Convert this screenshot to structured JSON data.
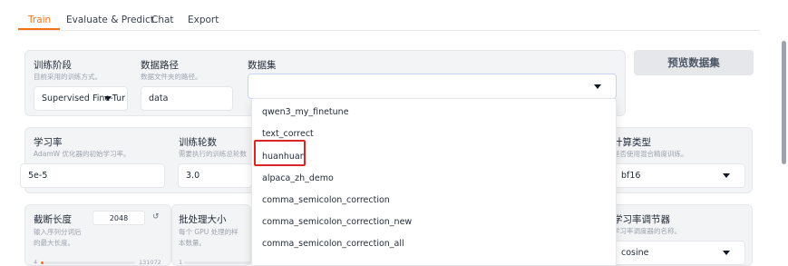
{
  "tabs": [
    {
      "label": "Train",
      "active": true
    },
    {
      "label": "Evaluate & Predict",
      "active": false
    },
    {
      "label": "Chat",
      "active": false
    },
    {
      "label": "Export",
      "active": false
    }
  ],
  "accent_color": "#f97316",
  "highlight_color": "#dc2626",
  "stage": {
    "label": "训练阶段",
    "desc": "目前采用的训练方式。",
    "value": "Supervised Fine-Tur"
  },
  "data_path": {
    "label": "数据路径",
    "desc": "数据文件夹的路径。",
    "value": "data"
  },
  "dataset": {
    "label": "数据集",
    "value": ""
  },
  "preview_button": {
    "label": "预览数据集"
  },
  "learning_rate": {
    "label": "学习率",
    "desc": "AdamW 优化器的初始学习率。",
    "value": "5e-5"
  },
  "epochs": {
    "label": "训练轮数",
    "desc": "需要执行的训练总轮数",
    "value": "3.0"
  },
  "compute_type": {
    "label": "计算类型",
    "desc": "是否使用混合精度训练。",
    "value": "bf16"
  },
  "cutoff_len": {
    "label": "截断长度",
    "desc_line1": "输入序列分词后",
    "desc_line2": "的最大长度。",
    "value": "2048",
    "min": "4",
    "max": "131072",
    "level_fraction": 0.015
  },
  "batch_size": {
    "label": "批处理大小",
    "desc_line1": "每个 GPU 处理的样",
    "desc_line2": "本数量。",
    "min": "1",
    "max": "1024"
  },
  "other_slider": {
    "min": "0"
  },
  "lr_scheduler": {
    "label": "学习率调节器",
    "desc": "学习率调度器的名称。",
    "value": "cosine"
  },
  "dataset_options": [
    "qwen3_my_finetune",
    "text_correct",
    "huanhuan",
    "alpaca_zh_demo",
    "comma_semicolon_correction",
    "comma_semicolon_correction_new",
    "comma_semicolon_correction_all"
  ],
  "highlighted_option_index": 2
}
